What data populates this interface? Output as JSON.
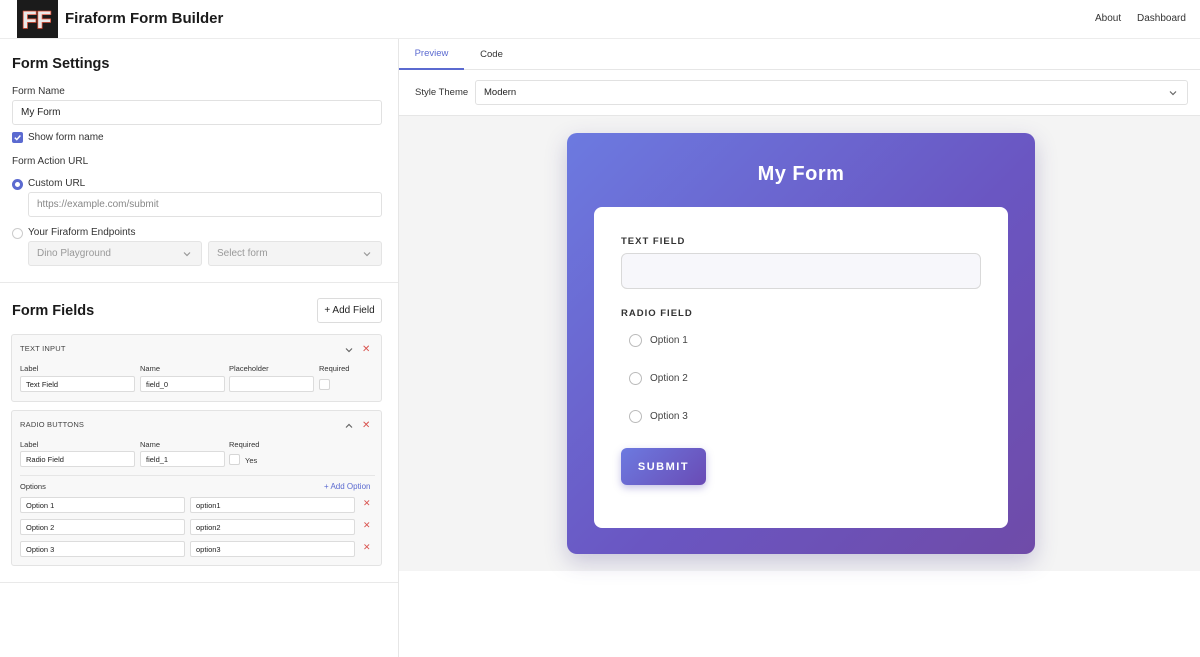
{
  "app": {
    "title": "Firaform Form Builder",
    "logo_text": "FF"
  },
  "nav": {
    "about": "About",
    "dashboard": "Dashboard"
  },
  "settings": {
    "title": "Form Settings",
    "form_name_label": "Form Name",
    "form_name_value": "My Form",
    "show_name_label": "Show form name",
    "show_name_checked": true,
    "action_url_label": "Form Action URL",
    "custom_url_label": "Custom URL",
    "custom_url_placeholder": "https://example.com/submit",
    "endpoints_label": "Your Firaform Endpoints",
    "endpoint_project": "Dino Playground",
    "endpoint_form": "Select form"
  },
  "fields": {
    "title": "Form Fields",
    "add_field": "+ Add Field",
    "text_input": {
      "type_label": "TEXT INPUT",
      "label_hdr": "Label",
      "name_hdr": "Name",
      "placeholder_hdr": "Placeholder",
      "required_hdr": "Required",
      "label_value": "Text Field",
      "name_value": "field_0",
      "placeholder_value": ""
    },
    "radio": {
      "type_label": "RADIO BUTTONS",
      "label_hdr": "Label",
      "name_hdr": "Name",
      "required_hdr": "Required",
      "label_value": "Radio Field",
      "name_value": "field_1",
      "required_text": "Yes",
      "options_label": "Options",
      "add_option": "+ Add Option",
      "options": [
        {
          "label": "Option 1",
          "value": "option1"
        },
        {
          "label": "Option 2",
          "value": "option2"
        },
        {
          "label": "Option 3",
          "value": "option3"
        }
      ]
    }
  },
  "preview": {
    "tabs": [
      "Preview",
      "Code"
    ],
    "style_theme_label": "Style Theme",
    "style_theme_value": "Modern",
    "form_title": "My Form",
    "text_field_label": "TEXT FIELD",
    "radio_field_label": "RADIO FIELD",
    "radio_options": [
      "Option 1",
      "Option 2",
      "Option 3"
    ],
    "submit": "SUBMIT"
  },
  "colors": {
    "accent": "#5b6ad0",
    "delete": "#d9534f",
    "gradient_start": "#6c7ae0",
    "gradient_end": "#6f4ba8"
  }
}
